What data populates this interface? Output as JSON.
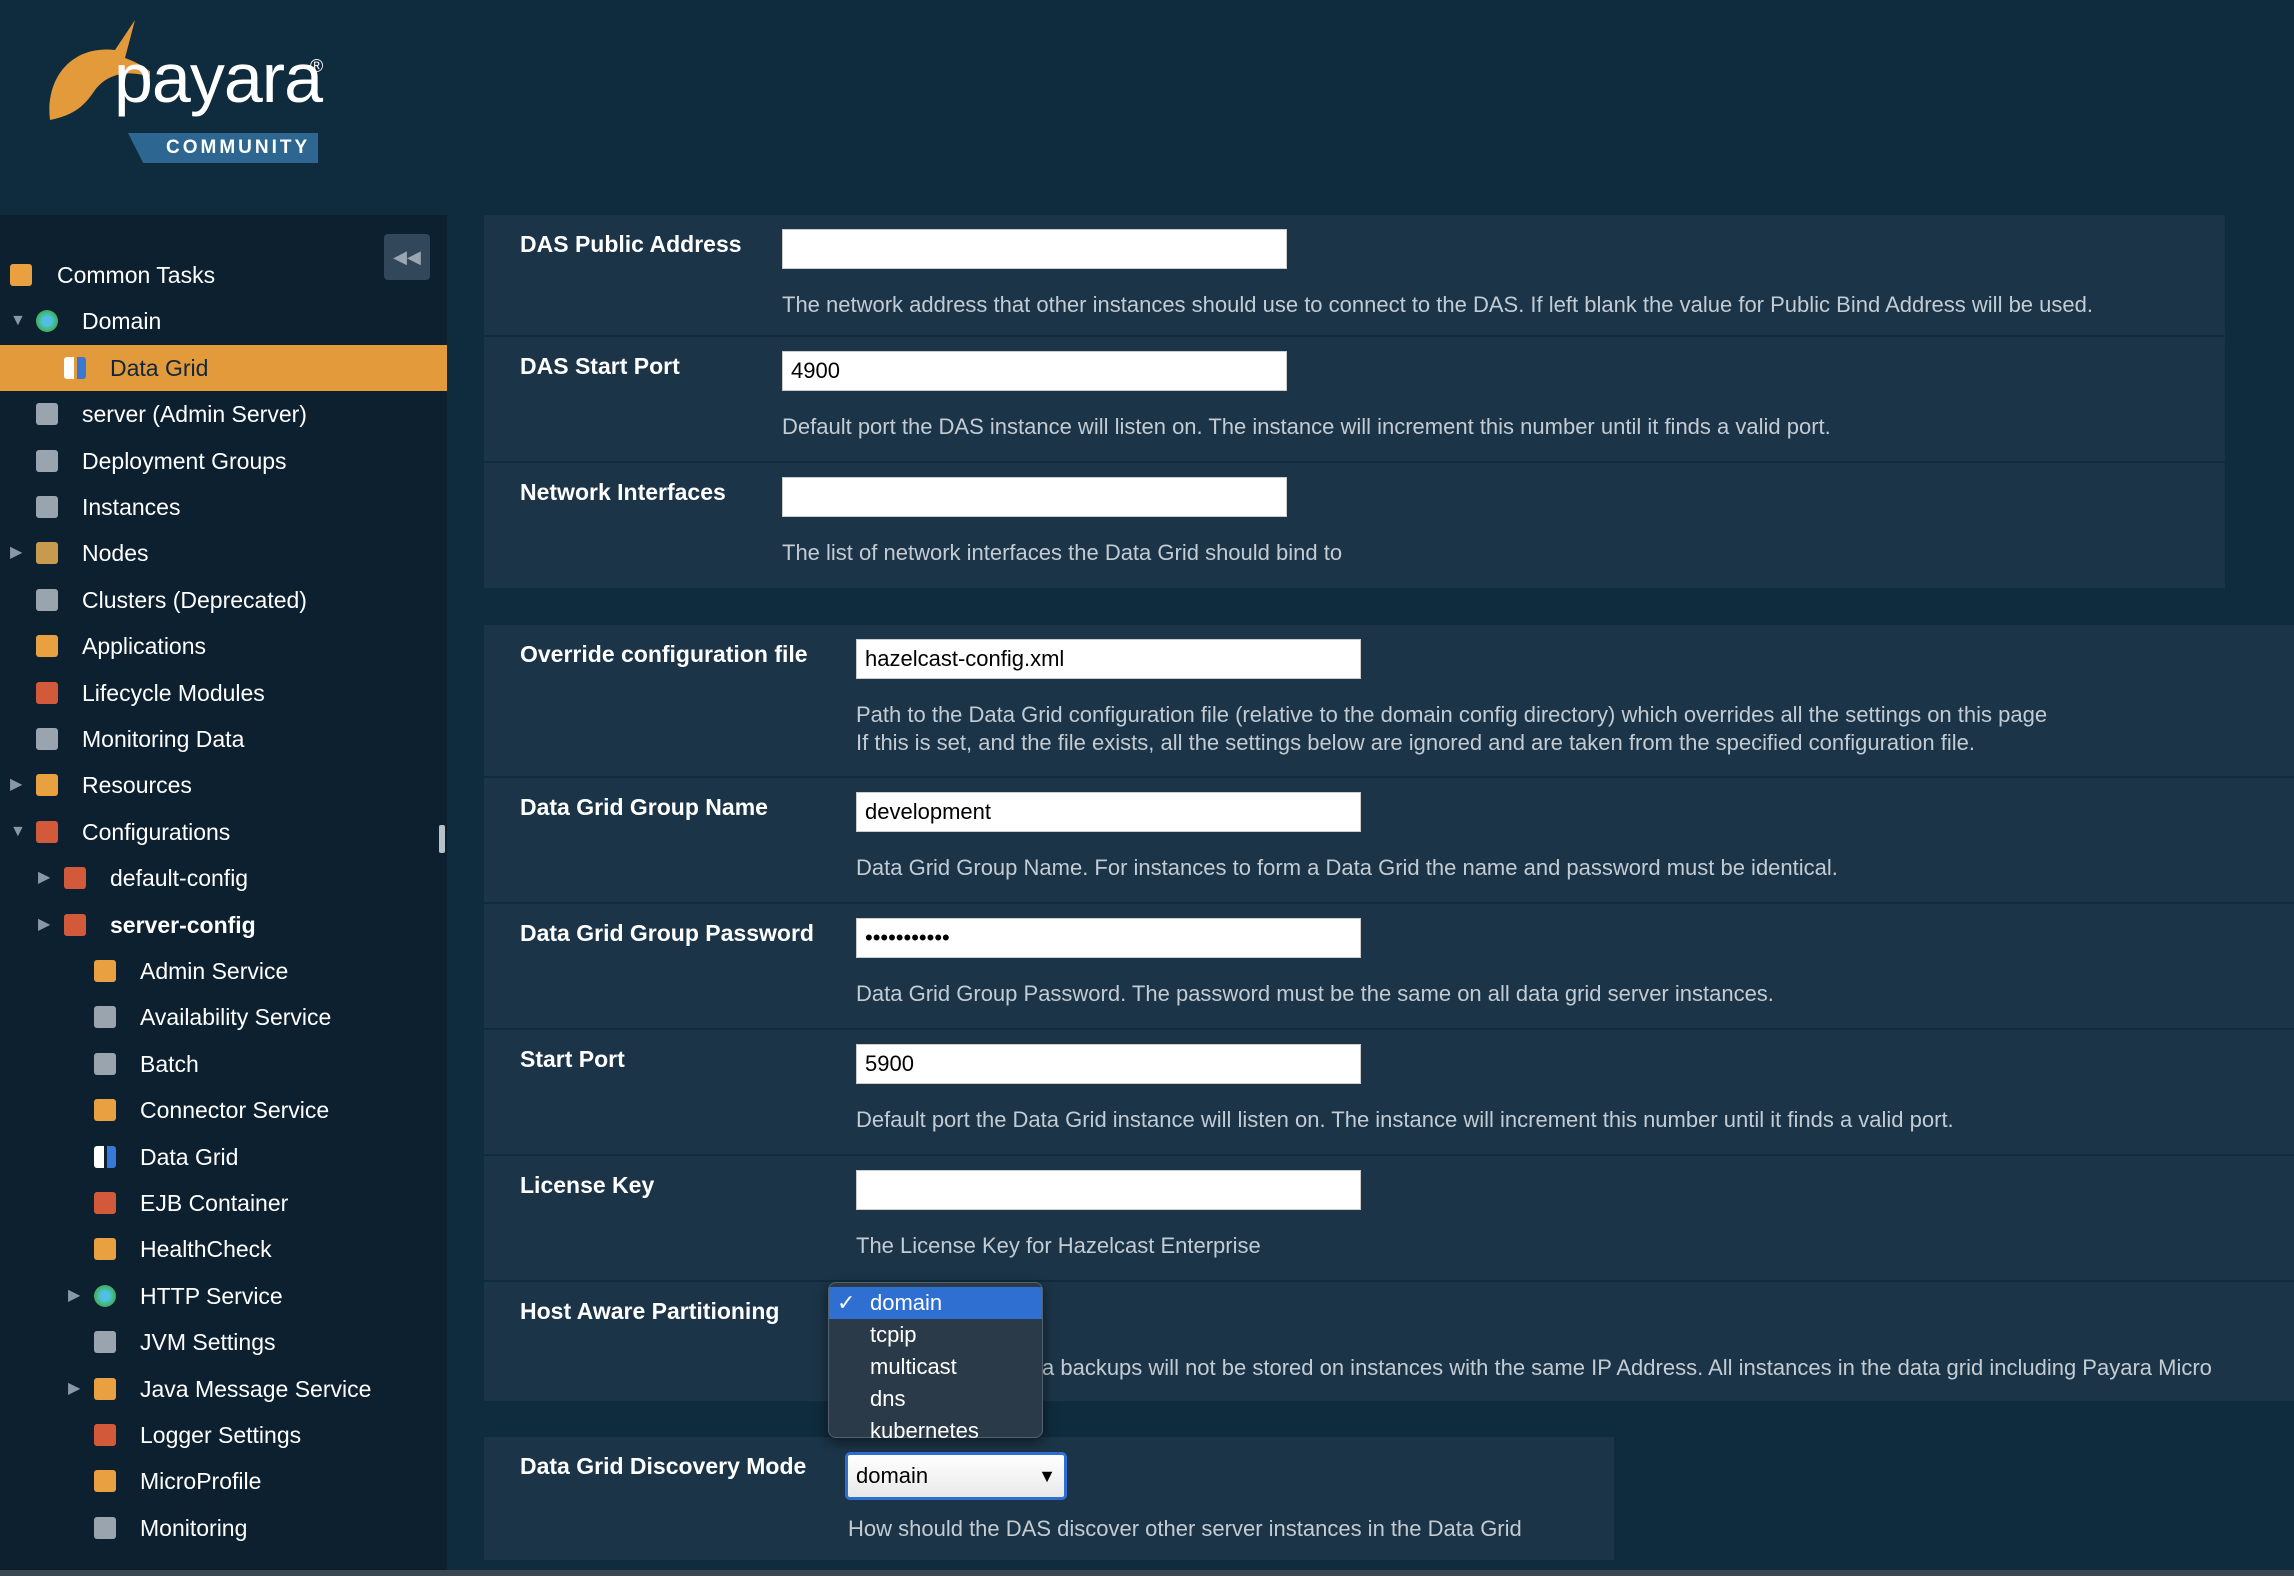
{
  "brand": {
    "name": "payara",
    "edition": "COMMUNITY",
    "accent": "#e39a3b"
  },
  "sidebar": {
    "collapse_icon": "double-chevron-left-icon",
    "items": [
      {
        "label": "Common Tasks",
        "level": 0,
        "icon": "tasks-icon",
        "color": "#e8a040"
      },
      {
        "label": "Domain",
        "level": 1,
        "icon": "globe-icon",
        "color": "#3fb04f",
        "expander": "down"
      },
      {
        "label": "Data Grid",
        "level": 2,
        "icon": "data-grid-icon",
        "color": "#ffffff",
        "selected": true
      },
      {
        "label": "server (Admin Server)",
        "level": 1,
        "icon": "server-icon",
        "color": "#9aa4ae"
      },
      {
        "label": "Deployment Groups",
        "level": 1,
        "icon": "cluster-icon",
        "color": "#9aa4ae"
      },
      {
        "label": "Instances",
        "level": 1,
        "icon": "server-icon",
        "color": "#9aa4ae"
      },
      {
        "label": "Nodes",
        "level": 1,
        "icon": "monitor-icon",
        "color": "#c89a50",
        "expander": "right"
      },
      {
        "label": "Clusters (Deprecated)",
        "level": 1,
        "icon": "cluster-icon",
        "color": "#9aa4ae"
      },
      {
        "label": "Applications",
        "level": 1,
        "icon": "applications-icon",
        "color": "#e8a040"
      },
      {
        "label": "Lifecycle Modules",
        "level": 1,
        "icon": "lifecycle-icon",
        "color": "#d25a3a"
      },
      {
        "label": "Monitoring Data",
        "level": 1,
        "icon": "monitor-icon",
        "color": "#9aa4ae"
      },
      {
        "label": "Resources",
        "level": 1,
        "icon": "resources-icon",
        "color": "#e8a040",
        "expander": "right"
      },
      {
        "label": "Configurations",
        "level": 1,
        "icon": "configurations-icon",
        "color": "#d25a3a",
        "expander": "down"
      },
      {
        "label": "default-config",
        "level": 2,
        "icon": "config-icon",
        "color": "#d25a3a",
        "expander": "right"
      },
      {
        "label": "server-config",
        "level": 2,
        "icon": "config-icon",
        "color": "#d25a3a",
        "expander": "right",
        "bold": true
      },
      {
        "label": "Admin Service",
        "level": 3,
        "icon": "puzzle-icon",
        "color": "#e8a040"
      },
      {
        "label": "Availability Service",
        "level": 3,
        "icon": "availability-icon",
        "color": "#9aa4ae"
      },
      {
        "label": "Batch",
        "level": 3,
        "icon": "batch-icon",
        "color": "#9aa4ae"
      },
      {
        "label": "Connector Service",
        "level": 3,
        "icon": "puzzle-icon",
        "color": "#e8a040"
      },
      {
        "label": "Data Grid",
        "level": 3,
        "icon": "data-grid-icon",
        "color": "#ffffff"
      },
      {
        "label": "EJB Container",
        "level": 3,
        "icon": "jar-icon",
        "color": "#d25a3a"
      },
      {
        "label": "HealthCheck",
        "level": 3,
        "icon": "heart-icon",
        "color": "#e8a040"
      },
      {
        "label": "HTTP Service",
        "level": 3,
        "icon": "globe-icon",
        "color": "#3fb04f",
        "expander": "right"
      },
      {
        "label": "JVM Settings",
        "level": 3,
        "icon": "coffee-icon",
        "color": "#9aa4ae"
      },
      {
        "label": "Java Message Service",
        "level": 3,
        "icon": "arrows-icon",
        "color": "#e8a040",
        "expander": "right"
      },
      {
        "label": "Logger Settings",
        "level": 3,
        "icon": "log-icon",
        "color": "#d25a3a"
      },
      {
        "label": "MicroProfile",
        "level": 3,
        "icon": "microprofile-icon",
        "color": "#e8a040"
      },
      {
        "label": "Monitoring",
        "level": 3,
        "icon": "monitor-icon",
        "color": "#9aa4ae"
      }
    ]
  },
  "das": {
    "rows": [
      {
        "label": "DAS Public Address",
        "value": "",
        "desc": "The network address that other instances should use to connect to the DAS. If left blank the value for Public Bind Address will be used."
      },
      {
        "label": "DAS Start Port",
        "value": "4900",
        "desc": "Default port the DAS instance will listen on. The instance will increment this number until it finds a valid port."
      },
      {
        "label": "Network Interfaces",
        "value": "",
        "desc": "The list of network interfaces the Data Grid should bind to"
      }
    ]
  },
  "grid": {
    "rows": [
      {
        "label": "Override configuration file",
        "value": "hazelcast-config.xml",
        "desc": "Path to the Data Grid configuration file (relative to the domain config directory) which overrides all the settings on this page",
        "desc2": "If this is set, and the file exists, all the settings below are ignored and are taken from the specified configuration file."
      },
      {
        "label": "Data Grid Group Name",
        "value": "development",
        "desc": "Data Grid Group Name. For instances to form a Data Grid the name and password must be identical."
      },
      {
        "label": "Data Grid Group Password",
        "value": "•••••••••••",
        "desc": "Data Grid Group Password. The password must be the same on all data grid server instances."
      },
      {
        "label": "Start Port",
        "value": "5900",
        "desc": "Default port the Data Grid instance will listen on. The instance will increment this number until it finds a valid port."
      },
      {
        "label": "License Key",
        "value": "",
        "desc": "The License Key for Hazelcast Enterprise"
      },
      {
        "label": "Host Aware Partitioning",
        "desc": "a backups will not be stored on instances with the same IP Address. All instances in the data grid including Payara Micro"
      }
    ]
  },
  "discovery": {
    "label": "Data Grid Discovery Mode",
    "value": "domain",
    "desc": "How should the DAS discover other server instances in the Data Grid",
    "options": [
      "domain",
      "tcpip",
      "multicast",
      "dns",
      "kubernetes"
    ],
    "selected": "domain"
  }
}
